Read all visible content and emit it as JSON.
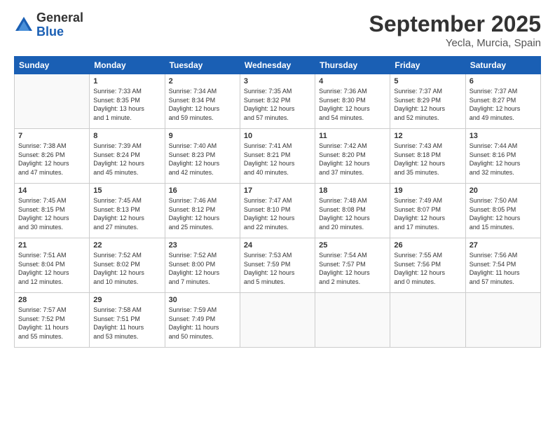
{
  "logo": {
    "line1": "General",
    "line2": "Blue"
  },
  "header": {
    "month": "September 2025",
    "location": "Yecla, Murcia, Spain"
  },
  "days_of_week": [
    "Sunday",
    "Monday",
    "Tuesday",
    "Wednesday",
    "Thursday",
    "Friday",
    "Saturday"
  ],
  "weeks": [
    [
      {
        "day": "",
        "info": ""
      },
      {
        "day": "1",
        "info": "Sunrise: 7:33 AM\nSunset: 8:35 PM\nDaylight: 13 hours\nand 1 minute."
      },
      {
        "day": "2",
        "info": "Sunrise: 7:34 AM\nSunset: 8:34 PM\nDaylight: 12 hours\nand 59 minutes."
      },
      {
        "day": "3",
        "info": "Sunrise: 7:35 AM\nSunset: 8:32 PM\nDaylight: 12 hours\nand 57 minutes."
      },
      {
        "day": "4",
        "info": "Sunrise: 7:36 AM\nSunset: 8:30 PM\nDaylight: 12 hours\nand 54 minutes."
      },
      {
        "day": "5",
        "info": "Sunrise: 7:37 AM\nSunset: 8:29 PM\nDaylight: 12 hours\nand 52 minutes."
      },
      {
        "day": "6",
        "info": "Sunrise: 7:37 AM\nSunset: 8:27 PM\nDaylight: 12 hours\nand 49 minutes."
      }
    ],
    [
      {
        "day": "7",
        "info": "Sunrise: 7:38 AM\nSunset: 8:26 PM\nDaylight: 12 hours\nand 47 minutes."
      },
      {
        "day": "8",
        "info": "Sunrise: 7:39 AM\nSunset: 8:24 PM\nDaylight: 12 hours\nand 45 minutes."
      },
      {
        "day": "9",
        "info": "Sunrise: 7:40 AM\nSunset: 8:23 PM\nDaylight: 12 hours\nand 42 minutes."
      },
      {
        "day": "10",
        "info": "Sunrise: 7:41 AM\nSunset: 8:21 PM\nDaylight: 12 hours\nand 40 minutes."
      },
      {
        "day": "11",
        "info": "Sunrise: 7:42 AM\nSunset: 8:20 PM\nDaylight: 12 hours\nand 37 minutes."
      },
      {
        "day": "12",
        "info": "Sunrise: 7:43 AM\nSunset: 8:18 PM\nDaylight: 12 hours\nand 35 minutes."
      },
      {
        "day": "13",
        "info": "Sunrise: 7:44 AM\nSunset: 8:16 PM\nDaylight: 12 hours\nand 32 minutes."
      }
    ],
    [
      {
        "day": "14",
        "info": "Sunrise: 7:45 AM\nSunset: 8:15 PM\nDaylight: 12 hours\nand 30 minutes."
      },
      {
        "day": "15",
        "info": "Sunrise: 7:45 AM\nSunset: 8:13 PM\nDaylight: 12 hours\nand 27 minutes."
      },
      {
        "day": "16",
        "info": "Sunrise: 7:46 AM\nSunset: 8:12 PM\nDaylight: 12 hours\nand 25 minutes."
      },
      {
        "day": "17",
        "info": "Sunrise: 7:47 AM\nSunset: 8:10 PM\nDaylight: 12 hours\nand 22 minutes."
      },
      {
        "day": "18",
        "info": "Sunrise: 7:48 AM\nSunset: 8:08 PM\nDaylight: 12 hours\nand 20 minutes."
      },
      {
        "day": "19",
        "info": "Sunrise: 7:49 AM\nSunset: 8:07 PM\nDaylight: 12 hours\nand 17 minutes."
      },
      {
        "day": "20",
        "info": "Sunrise: 7:50 AM\nSunset: 8:05 PM\nDaylight: 12 hours\nand 15 minutes."
      }
    ],
    [
      {
        "day": "21",
        "info": "Sunrise: 7:51 AM\nSunset: 8:04 PM\nDaylight: 12 hours\nand 12 minutes."
      },
      {
        "day": "22",
        "info": "Sunrise: 7:52 AM\nSunset: 8:02 PM\nDaylight: 12 hours\nand 10 minutes."
      },
      {
        "day": "23",
        "info": "Sunrise: 7:52 AM\nSunset: 8:00 PM\nDaylight: 12 hours\nand 7 minutes."
      },
      {
        "day": "24",
        "info": "Sunrise: 7:53 AM\nSunset: 7:59 PM\nDaylight: 12 hours\nand 5 minutes."
      },
      {
        "day": "25",
        "info": "Sunrise: 7:54 AM\nSunset: 7:57 PM\nDaylight: 12 hours\nand 2 minutes."
      },
      {
        "day": "26",
        "info": "Sunrise: 7:55 AM\nSunset: 7:56 PM\nDaylight: 12 hours\nand 0 minutes."
      },
      {
        "day": "27",
        "info": "Sunrise: 7:56 AM\nSunset: 7:54 PM\nDaylight: 11 hours\nand 57 minutes."
      }
    ],
    [
      {
        "day": "28",
        "info": "Sunrise: 7:57 AM\nSunset: 7:52 PM\nDaylight: 11 hours\nand 55 minutes."
      },
      {
        "day": "29",
        "info": "Sunrise: 7:58 AM\nSunset: 7:51 PM\nDaylight: 11 hours\nand 53 minutes."
      },
      {
        "day": "30",
        "info": "Sunrise: 7:59 AM\nSunset: 7:49 PM\nDaylight: 11 hours\nand 50 minutes."
      },
      {
        "day": "",
        "info": ""
      },
      {
        "day": "",
        "info": ""
      },
      {
        "day": "",
        "info": ""
      },
      {
        "day": "",
        "info": ""
      }
    ]
  ]
}
